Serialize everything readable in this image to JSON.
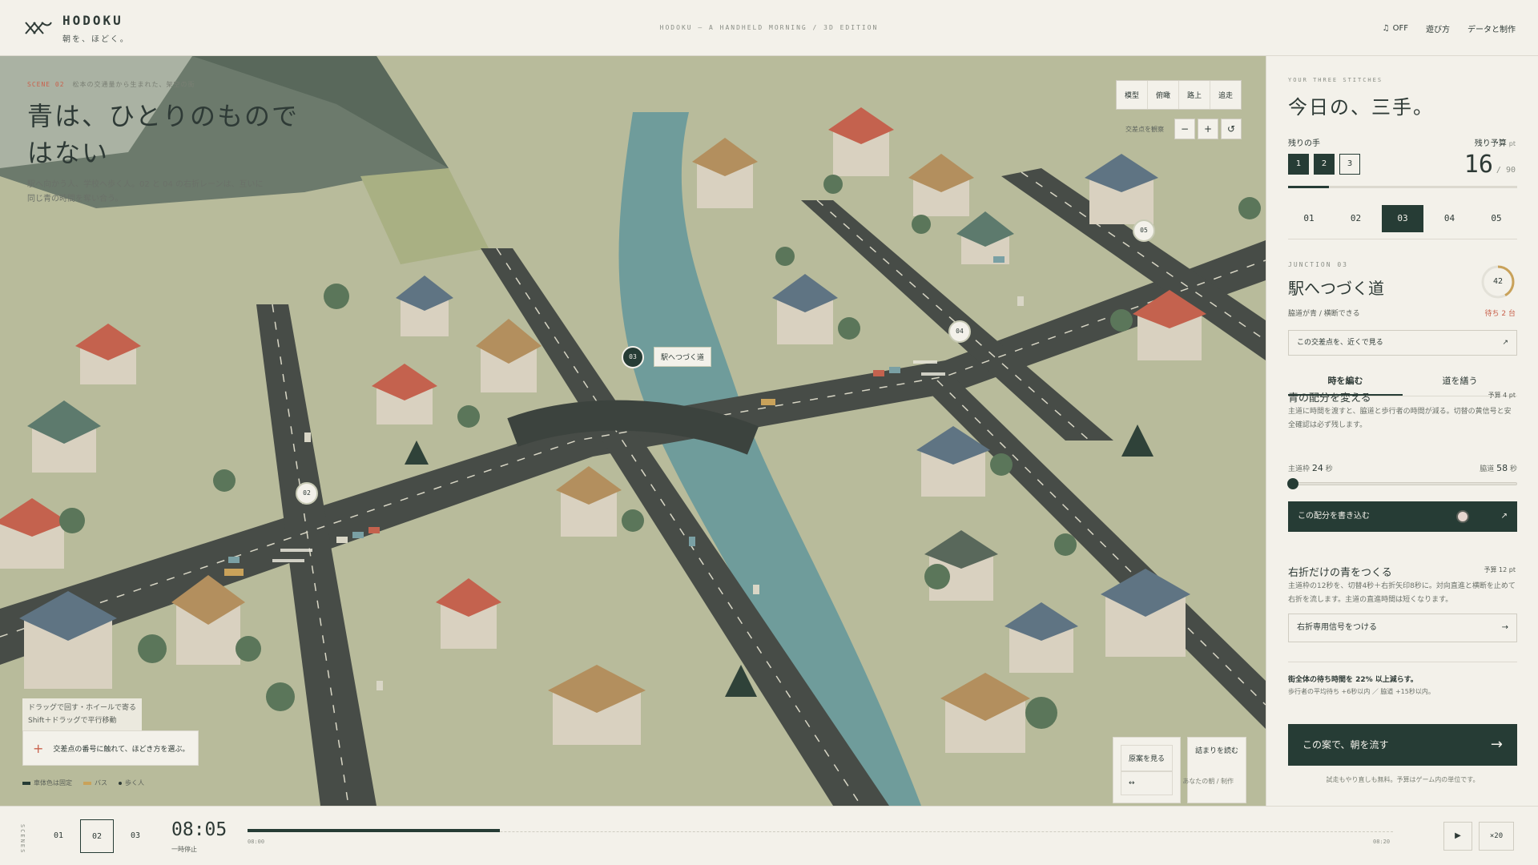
{
  "header": {
    "brand": "HODOKU",
    "tagline": "朝を、ほどく。",
    "edition": "HODOKU — A HANDHELD MORNING / 3D EDITION",
    "sound_label": "OFF",
    "nav": [
      "遊び方",
      "データと制作"
    ]
  },
  "scene": {
    "number": "SCENE 02",
    "caption": "松本の交通量から生まれた、架空の街",
    "title": "青は、ひとりのものではない",
    "description": "駅へ向かう人、学校へ歩く人。02 と 04 の右折レーンは、互いに同じ青の時間を奪い合う。"
  },
  "view_modes": [
    "模型",
    "俯瞰",
    "路上",
    "追走"
  ],
  "zoom": {
    "label": "交差点を観察",
    "minus": "−",
    "plus": "+",
    "reset": "↺"
  },
  "junction_markers": [
    {
      "id": "02",
      "active": false
    },
    {
      "id": "03",
      "active": true,
      "tag": "駅へつづく道"
    },
    {
      "id": "04",
      "active": false
    },
    {
      "id": "05",
      "active": false
    }
  ],
  "map_hint": {
    "line1": "ドラッグで回す・ホイールで寄る",
    "line2": "Shift＋ドラッグで平行移動"
  },
  "map_tip": {
    "icon": "+",
    "text": "交差点の番号に触れて、ほどき方を選ぶ。"
  },
  "legend": [
    {
      "label": "車体色は固定",
      "color": "#263c35"
    },
    {
      "label": "バス",
      "color": "#c9a25a"
    },
    {
      "label": "歩く人",
      "color": "#2e3a36"
    }
  ],
  "map_buttons": {
    "original": "原案を見る",
    "original_icon": "↔",
    "jam": "詰まりを読む"
  },
  "map_credit": "あなたの朝 / 制作",
  "panel": {
    "eyebrow": "YOUR THREE STITCHES",
    "title": "今日の、三手。",
    "moves_label": "残りの手",
    "moves": [
      {
        "n": "1",
        "used": true
      },
      {
        "n": "2",
        "used": true
      },
      {
        "n": "3",
        "used": false
      }
    ],
    "budget_label": "残り予算",
    "budget_unit": "pt",
    "budget_value": "16",
    "budget_max": "/ 90",
    "budget_fraction": 0.18,
    "junction_tabs": [
      "01",
      "02",
      "03",
      "04",
      "05"
    ],
    "junction_active": "03",
    "junction_eyebrow": "JUNCTION 03",
    "junction_title": "駅へつづく道",
    "junction_ring_value": "42",
    "junction_ring_fraction": 0.42,
    "junction_sub": "脇道が青 / 横断できる",
    "junction_wait": "待ち 2 台",
    "closeup_label": "この交差点を、近くで見る",
    "closeup_icon": "↗",
    "mode_tabs": [
      "時を編む",
      "道を繕う"
    ],
    "option1": {
      "title": "青の配分を変える",
      "cost": "予算 4 pt",
      "desc": "主道に時間を渡すと、脇道と歩行者の時間が減る。切替の黄信号と安全確認は必ず残します。",
      "main_label": "主道枠",
      "main_value": "24",
      "side_label": "脇道",
      "side_value": "58",
      "unit": "秒",
      "slider_fraction": 0.0,
      "commit_label": "この配分を書き込む",
      "commit_icon": "↗"
    },
    "option2": {
      "title": "右折だけの青をつくる",
      "cost": "予算 12 pt",
      "desc": "主道枠の12秒を、切替4秒＋右折矢印8秒に。対向直進と横断を止めて右折を流します。主道の直進時間は短くなります。",
      "button": "右折専用信号をつける",
      "icon": "→"
    },
    "result": {
      "line1": "街全体の待ち時間を 22% 以上減らす。",
      "line2": "歩行者の平均待ち +6秒以内 ／ 脇道 +15秒以内。"
    },
    "go_label": "この案で、朝を流す",
    "go_icon": "→",
    "note": "試走もやり直しも無料。予算はゲーム内の単位です。"
  },
  "footer": {
    "scenes_label": "SCENES",
    "scene_tabs": [
      "01",
      "02",
      "03"
    ],
    "scene_active": "02",
    "clock": "08:05",
    "clock_sub": "一時停止",
    "t_start": "08:00",
    "t_end": "08:20",
    "progress_fraction": 0.22,
    "play": "▶",
    "speed": "×20"
  },
  "colors": {
    "accent": "#263c35",
    "alert": "#c9624d",
    "paper": "#f3f1ea"
  }
}
